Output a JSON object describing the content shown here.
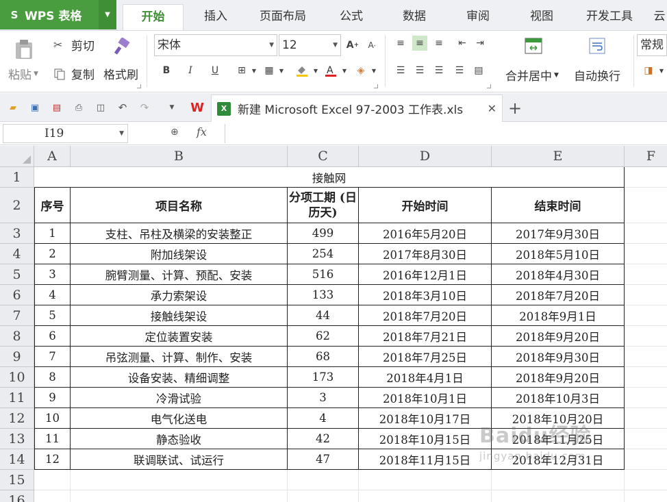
{
  "app": {
    "logo_text": "WPS 表格",
    "logo_mark": "S"
  },
  "ribbon_tabs": [
    {
      "label": "开始",
      "active": true
    },
    {
      "label": "插入"
    },
    {
      "label": "页面布局"
    },
    {
      "label": "公式"
    },
    {
      "label": "数据"
    },
    {
      "label": "审阅"
    },
    {
      "label": "视图"
    },
    {
      "label": "开发工具"
    },
    {
      "label": "云"
    }
  ],
  "ribbon": {
    "paste": "粘贴",
    "cut": "剪切",
    "copy": "复制",
    "format_painter": "格式刷",
    "font_name": "宋体",
    "font_size": "12",
    "merge_center": "合并居中",
    "wrap_text": "自动换行",
    "number_format": "常规",
    "bold": "B",
    "italic": "I",
    "underline": "U"
  },
  "document_tab": {
    "title": "新建 Microsoft Excel 97-2003 工作表.xls",
    "xl_mark": "X"
  },
  "formula_bar": {
    "name_box": "I19",
    "fx": "fx",
    "value": ""
  },
  "columns": [
    "A",
    "B",
    "C",
    "D",
    "E",
    "F"
  ],
  "rows": [
    "1",
    "2",
    "3",
    "4",
    "5",
    "6",
    "7",
    "8",
    "9",
    "10",
    "11",
    "12",
    "13",
    "14",
    "15",
    "16"
  ],
  "table": {
    "title": "接触网",
    "headers": [
      "序号",
      "项目名称",
      "分项工期 (日历天)",
      "开始时间",
      "结束时间"
    ],
    "data": [
      [
        "1",
        "支柱、吊柱及横梁的安装整正",
        "499",
        "2016年5月20日",
        "2017年9月30日"
      ],
      [
        "2",
        "附加线架设",
        "254",
        "2017年8月30日",
        "2018年5月10日"
      ],
      [
        "3",
        "腕臂测量、计算、预配、安装",
        "516",
        "2016年12月1日",
        "2018年4月30日"
      ],
      [
        "4",
        "承力索架设",
        "133",
        "2018年3月10日",
        "2018年7月20日"
      ],
      [
        "5",
        "接触线架设",
        "44",
        "2018年7月20日",
        "2018年9月1日"
      ],
      [
        "6",
        "定位装置安装",
        "62",
        "2018年7月21日",
        "2018年9月20日"
      ],
      [
        "7",
        "吊弦测量、计算、制作、安装",
        "68",
        "2018年7月25日",
        "2018年9月30日"
      ],
      [
        "8",
        "设备安装、精细调整",
        "173",
        "2018年4月1日",
        "2018年9月20日"
      ],
      [
        "9",
        "冷滑试验",
        "3",
        "2018年10月1日",
        "2018年10月3日"
      ],
      [
        "10",
        "电气化送电",
        "4",
        "2018年10月17日",
        "2018年10月20日"
      ],
      [
        "11",
        "静态验收",
        "42",
        "2018年10月15日",
        "2018年11月25日"
      ],
      [
        "12",
        "联调联试、试运行",
        "47",
        "2018年11月15日",
        "2018年12月31日"
      ]
    ]
  },
  "watermark": {
    "line1": "Baidu经验",
    "line2": "jingyan.baidu.com"
  },
  "colors": {
    "brand_green": "#4a9d3f",
    "tab_active_text": "#3f8f35"
  }
}
